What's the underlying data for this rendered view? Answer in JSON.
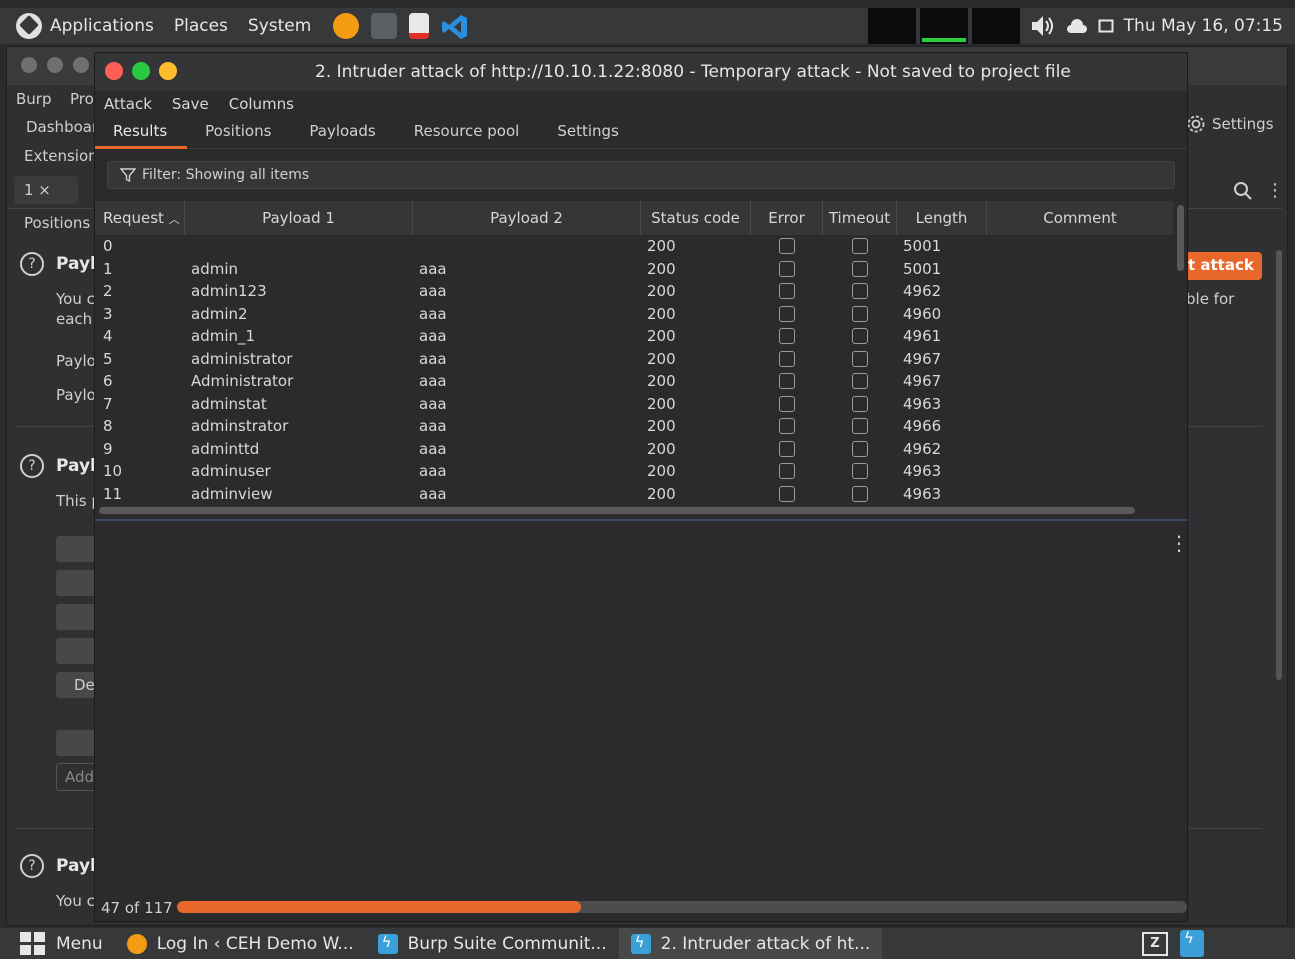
{
  "topbar": {
    "menus": [
      "Applications",
      "Places",
      "System"
    ],
    "datetime": "Thu May 16, 07:15",
    "launchers": [
      "firefox-icon",
      "terminal-icon",
      "text-editor-icon",
      "vscode-icon"
    ]
  },
  "background_window": {
    "menu": [
      "Burp",
      "Pro"
    ],
    "nav": [
      "Dashboar",
      "Extension"
    ],
    "tab_label": "1 ×",
    "side_label": "Positions",
    "settings_label": "Settings",
    "start_attack": "t attack",
    "sections": [
      {
        "heading": "Payl",
        "lines": [
          "You c",
          "each",
          "Paylo",
          "Paylo"
        ],
        "side_text": "ble for"
      },
      {
        "heading": "Payl",
        "lines": [
          "This p"
        ]
      },
      {
        "heading": "Payl",
        "lines": [
          "You c"
        ]
      }
    ],
    "buttons": [
      "",
      "",
      "",
      "",
      "De",
      ""
    ],
    "add_placeholder": "Add"
  },
  "attack_window": {
    "title": "2. Intruder attack of http://10.10.1.22:8080 - Temporary attack - Not saved to project file",
    "menu": [
      "Attack",
      "Save",
      "Columns"
    ],
    "tabs": [
      "Results",
      "Positions",
      "Payloads",
      "Resource pool",
      "Settings"
    ],
    "active_tab": "Results",
    "filter": "Filter: Showing all items",
    "columns": [
      "Request",
      "Payload 1",
      "Payload 2",
      "Status code",
      "Error",
      "Timeout",
      "Length",
      "Comment"
    ],
    "rows": [
      {
        "request": "0",
        "p1": "",
        "p2": "",
        "status": "200",
        "length": "5001"
      },
      {
        "request": "1",
        "p1": "admin",
        "p2": "aaa",
        "status": "200",
        "length": "5001"
      },
      {
        "request": "2",
        "p1": "admin123",
        "p2": "aaa",
        "status": "200",
        "length": "4962"
      },
      {
        "request": "3",
        "p1": "admin2",
        "p2": "aaa",
        "status": "200",
        "length": "4960"
      },
      {
        "request": "4",
        "p1": "admin_1",
        "p2": "aaa",
        "status": "200",
        "length": "4961"
      },
      {
        "request": "5",
        "p1": "administrator",
        "p2": "aaa",
        "status": "200",
        "length": "4967"
      },
      {
        "request": "6",
        "p1": "Administrator",
        "p2": "aaa",
        "status": "200",
        "length": "4967"
      },
      {
        "request": "7",
        "p1": "adminstat",
        "p2": "aaa",
        "status": "200",
        "length": "4963"
      },
      {
        "request": "8",
        "p1": "adminstrator",
        "p2": "aaa",
        "status": "200",
        "length": "4966"
      },
      {
        "request": "9",
        "p1": "adminttd",
        "p2": "aaa",
        "status": "200",
        "length": "4962"
      },
      {
        "request": "10",
        "p1": "adminuser",
        "p2": "aaa",
        "status": "200",
        "length": "4963"
      },
      {
        "request": "11",
        "p1": "adminview",
        "p2": "aaa",
        "status": "200",
        "length": "4963"
      }
    ],
    "progress_label": "47 of 117",
    "progress_value": 0.4
  },
  "taskbar": {
    "menu": "Menu",
    "items": [
      {
        "label": "Log In ‹ CEH Demo W...",
        "icon": "firefox-icon"
      },
      {
        "label": "Burp Suite Communit...",
        "icon": "burp-icon"
      },
      {
        "label": "2. Intruder attack of ht...",
        "icon": "burp-icon"
      }
    ]
  },
  "colors": {
    "accent": "#e8672b",
    "close": "#ff5f57",
    "minimize": "#28c840",
    "maximize": "#ffbd2e"
  }
}
